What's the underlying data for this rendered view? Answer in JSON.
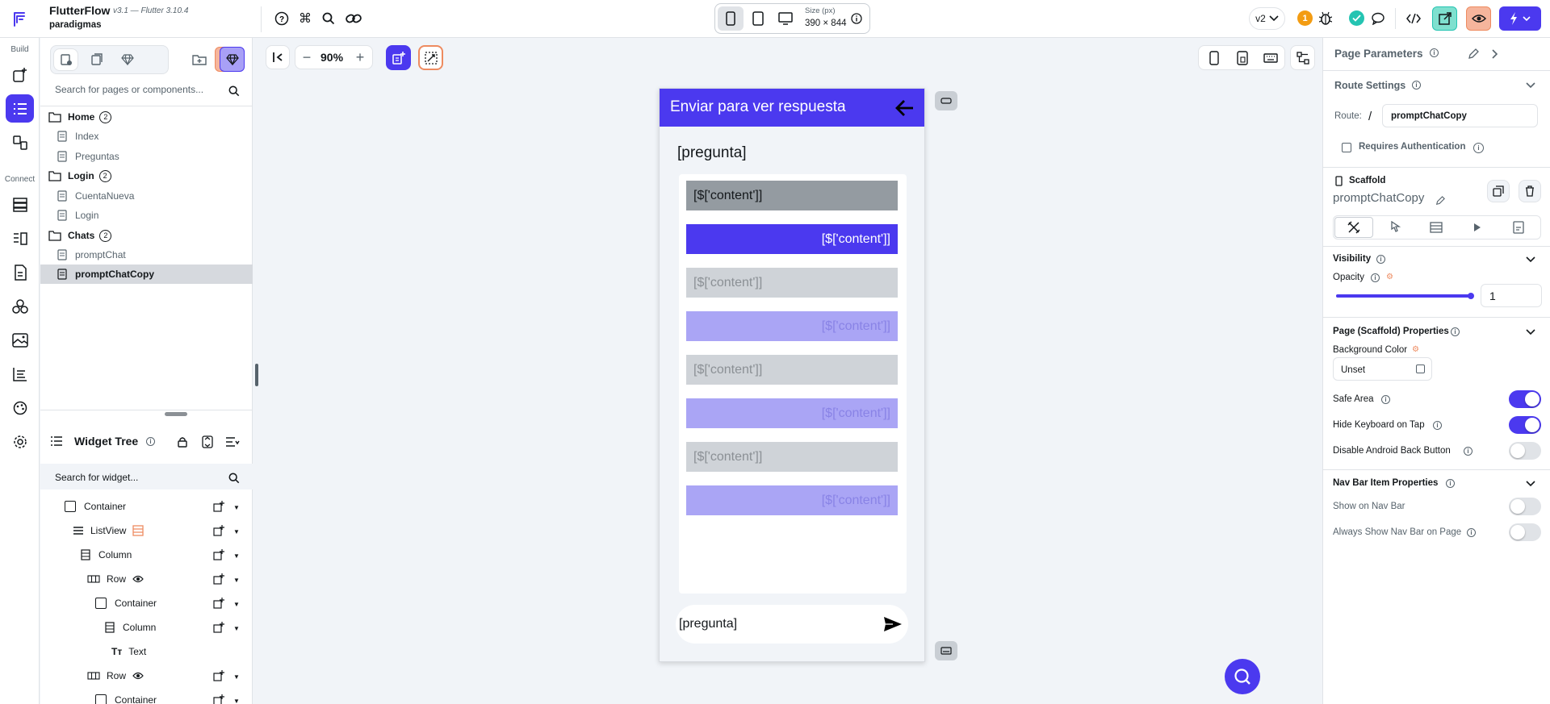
{
  "app": {
    "name": "FlutterFlow",
    "version": "v3.1 — Flutter 3.10.4",
    "project": "paradigmas"
  },
  "device": {
    "size_label": "Size (px)",
    "size_value": "390 × 844"
  },
  "topbar": {
    "branch": "v2",
    "notification_count": "1"
  },
  "rail": {
    "build_label": "Build",
    "connect_label": "Connect"
  },
  "pages_panel": {
    "search_placeholder": "Search for pages or components...",
    "folders": [
      {
        "name": "Home",
        "count": "2",
        "pages": [
          "Index",
          "Preguntas"
        ]
      },
      {
        "name": "Login",
        "count": "2",
        "pages": [
          "CuentaNueva",
          "Login"
        ]
      },
      {
        "name": "Chats",
        "count": "2",
        "pages": [
          "promptChat",
          "promptChatCopy"
        ]
      }
    ]
  },
  "widget_tree": {
    "title": "Widget Tree",
    "search_placeholder": "Search for widget...",
    "rows": [
      "Container",
      "ListView",
      "Column",
      "Row",
      "Container",
      "Column",
      "Text",
      "Row",
      "Container"
    ]
  },
  "canvas": {
    "zoom": "90%"
  },
  "phone": {
    "appbar_title": "Enviar para ver respuesta",
    "question": "[pregunta]",
    "bubble_text": "[$['content']]",
    "input_text": "[pregunta]",
    "colors": {
      "appbar": "#4b39ef",
      "bubble_gray": "#949ba1",
      "bubble_purple": "#4b39ef",
      "bubble_gray_light": "#cfd3d8",
      "bubble_purple_light": "#aaa5f5"
    }
  },
  "props": {
    "page_parameters": "Page Parameters",
    "route_settings": "Route Settings",
    "route_label": "Route:",
    "route_slash": "/",
    "route_value": "promptChatCopy",
    "requires_auth": "Requires Authentication",
    "scaffold_label": "Scaffold",
    "widget_name": "promptChatCopy",
    "visibility": "Visibility",
    "opacity_label": "Opacity",
    "opacity_value": "1",
    "scaffold_props": "Page (Scaffold) Properties",
    "bg_color_label": "Background Color",
    "bg_color_value": "Unset",
    "safe_area": "Safe Area",
    "hide_keyboard": "Hide Keyboard on Tap",
    "disable_back": "Disable Android Back Button",
    "nav_bar_props": "Nav Bar Item Properties",
    "show_nav_bar": "Show on Nav Bar",
    "always_show_nav": "Always Show Nav Bar on Page"
  }
}
